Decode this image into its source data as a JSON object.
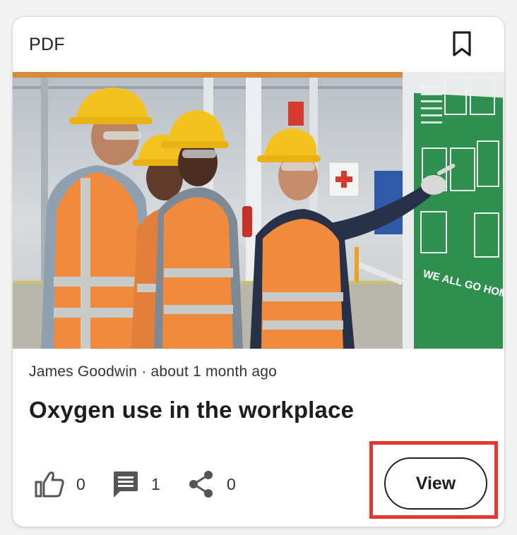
{
  "card": {
    "type_label": "PDF",
    "bookmark_icon": "bookmark-outline-icon",
    "image_alt": "Workers in hard hats and safety vests looking at a safety poster",
    "poster_text": "WE ALL GO HOME SAFE",
    "author": "James Goodwin",
    "separator": "·",
    "posted": "about 1 month ago",
    "title": "Oxygen use in the workplace"
  },
  "stats": {
    "likes": {
      "icon": "thumb-up-icon",
      "count": "0"
    },
    "comments": {
      "icon": "comment-icon",
      "count": "1"
    },
    "shares": {
      "icon": "share-icon",
      "count": "0"
    }
  },
  "actions": {
    "view_label": "View"
  },
  "colors": {
    "highlight": "#e2392b",
    "vest": "#f08a3c",
    "helmet": "#f4c21f",
    "poster": "#2f8f4e"
  }
}
